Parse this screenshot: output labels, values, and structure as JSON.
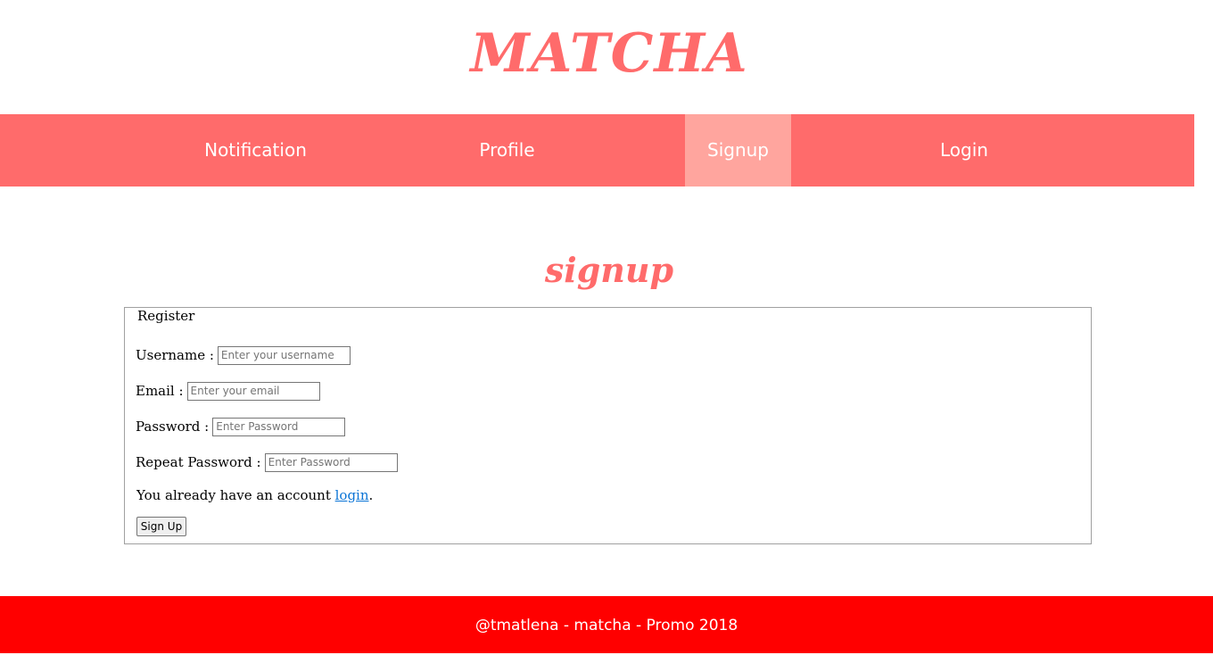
{
  "header": {
    "title": "MATCHA"
  },
  "nav": {
    "items": [
      {
        "label": "Notification",
        "active": false
      },
      {
        "label": "Profile",
        "active": false
      },
      {
        "label": "Signup",
        "active": true
      },
      {
        "label": "Login",
        "active": false
      }
    ]
  },
  "main": {
    "heading": "signup",
    "form": {
      "legend": "Register",
      "fields": [
        {
          "label": "Username :",
          "value": "",
          "placeholder": "Enter your username"
        },
        {
          "label": "Email :",
          "value": "",
          "placeholder": "Enter your email"
        },
        {
          "label": "Password :",
          "value": "",
          "placeholder": "Enter Password"
        },
        {
          "label": "Repeat Password :",
          "value": "",
          "placeholder": "Enter Password"
        }
      ],
      "account_text": "You already have an account ",
      "login_link": "login",
      "account_suffix": ".",
      "submit_label": "Sign Up"
    }
  },
  "footer": {
    "text": "@tmatlena - matcha - Promo 2018"
  },
  "colors": {
    "brand": "#ff6b6b",
    "nav_active": "#ffa59e",
    "footer": "#ff0000",
    "link": "#0a74d6"
  }
}
